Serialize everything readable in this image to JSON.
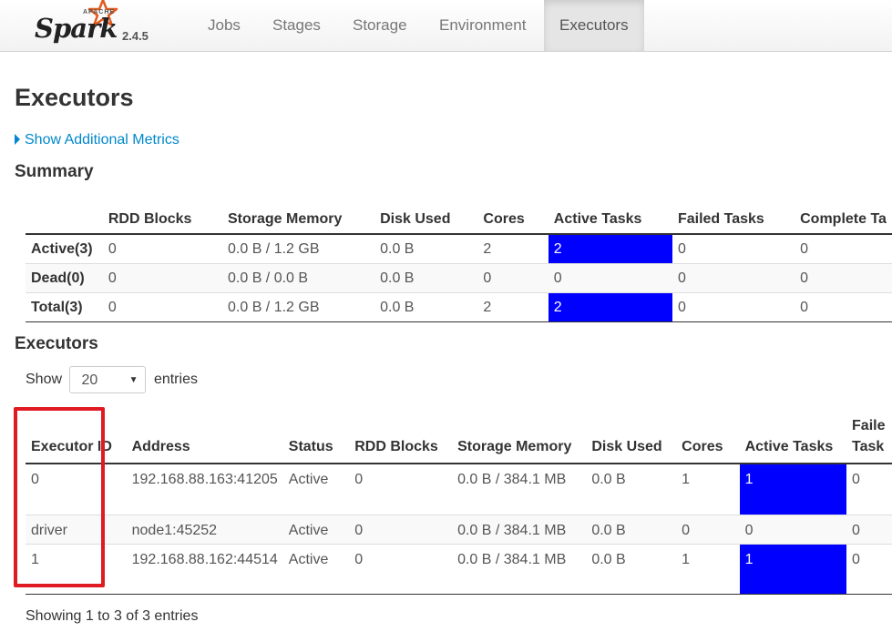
{
  "nav": {
    "brand_apache": "APACHE",
    "brand_name": "Spark",
    "version": "2.4.5",
    "tabs": [
      "Jobs",
      "Stages",
      "Storage",
      "Environment",
      "Executors"
    ],
    "active_tab": "Executors"
  },
  "page_title": "Executors",
  "show_additional_metrics": "Show Additional Metrics",
  "summary": {
    "heading": "Summary",
    "columns": [
      "",
      "RDD Blocks",
      "Storage Memory",
      "Disk Used",
      "Cores",
      "Active Tasks",
      "Failed Tasks",
      "Complete Ta"
    ],
    "rows": [
      [
        "Active(3)",
        "0",
        "0.0 B / 1.2 GB",
        "0.0 B",
        "2",
        "2",
        "0",
        "0"
      ],
      [
        "Dead(0)",
        "0",
        "0.0 B / 0.0 B",
        "0.0 B",
        "0",
        "0",
        "0",
        "0"
      ],
      [
        "Total(3)",
        "0",
        "0.0 B / 1.2 GB",
        "0.0 B",
        "2",
        "2",
        "0",
        "0"
      ]
    ]
  },
  "executors": {
    "heading": "Executors",
    "show_label": "Show",
    "entries_label": "entries",
    "page_size": "20",
    "columns": [
      "Executor ID",
      "Address",
      "Status",
      "RDD Blocks",
      "Storage Memory",
      "Disk Used",
      "Cores",
      "Active Tasks",
      "Faile Task"
    ],
    "rows": [
      [
        "0",
        "192.168.88.163:41205",
        "Active",
        "0",
        "0.0 B / 384.1 MB",
        "0.0 B",
        "1",
        "1",
        "0"
      ],
      [
        "driver",
        "node1:45252",
        "Active",
        "0",
        "0.0 B / 384.1 MB",
        "0.0 B",
        "0",
        "0",
        "0"
      ],
      [
        "1",
        "192.168.88.162:44514",
        "Active",
        "0",
        "0.0 B / 384.1 MB",
        "0.0 B",
        "1",
        "1",
        "0"
      ]
    ],
    "footer": "Showing 1 to 3 of 3 entries"
  },
  "colors": {
    "active_task_highlight": "#0000ff",
    "annotation_box": "#e01a22",
    "link": "#0088cc"
  }
}
